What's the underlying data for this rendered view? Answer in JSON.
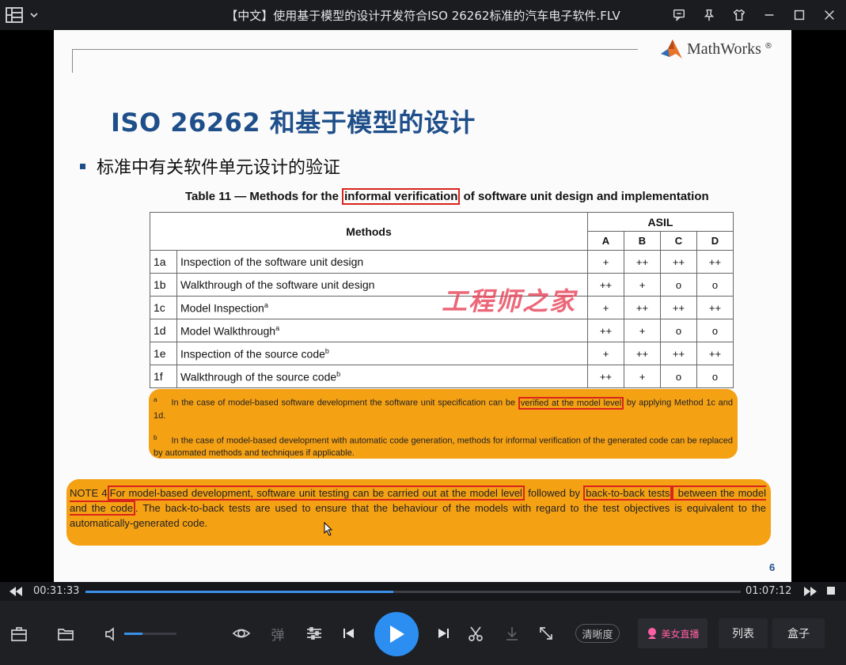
{
  "window": {
    "title": "【中文】使用基于模型的设计开发符合ISO 26262标准的汽车电子软件.FLV"
  },
  "slide": {
    "brand": "MathWorks",
    "brand_mark": "®",
    "title": "ISO 26262 和基于模型的设计",
    "bullet": "标准中有关软件单元设计的验证",
    "caption_pre": "Table 11 — Methods for the ",
    "caption_highlight": "informal verification",
    "caption_post": " of software unit design and implementation",
    "table": {
      "methods_header": "Methods",
      "asil_header": "ASIL",
      "levels": [
        "A",
        "B",
        "C",
        "D"
      ],
      "rows": [
        {
          "id": "1a",
          "name": "Inspection of the software unit design",
          "sup": "",
          "ratings": [
            "+",
            "++",
            "++",
            "++"
          ]
        },
        {
          "id": "1b",
          "name": "Walkthrough of the software unit design",
          "sup": "",
          "ratings": [
            "++",
            "+",
            "o",
            "o"
          ]
        },
        {
          "id": "1c",
          "name": "Model Inspection",
          "sup": "a",
          "ratings": [
            "+",
            "++",
            "++",
            "++"
          ]
        },
        {
          "id": "1d",
          "name": "Model Walkthrough",
          "sup": "a",
          "ratings": [
            "++",
            "+",
            "o",
            "o"
          ]
        },
        {
          "id": "1e",
          "name": "Inspection of the source code",
          "sup": "b",
          "ratings": [
            "+",
            "++",
            "++",
            "++"
          ]
        },
        {
          "id": "1f",
          "name": "Walkthrough of the source code",
          "sup": "b",
          "ratings": [
            "++",
            "+",
            "o",
            "o"
          ]
        }
      ]
    },
    "footnote_a": {
      "mark": "a",
      "pre": "In the case of model-based software development the software unit specification can be ",
      "highlight": "verified at the model level",
      "post": " by applying Method 1c and 1d."
    },
    "footnote_b": {
      "mark": "b",
      "text": "In the case of model-based development with automatic code generation, methods for informal verification of the generated code can be replaced by automated methods and techniques if applicable."
    },
    "note": {
      "label": "NOTE 4",
      "hl1": "For model-based development, software unit testing can be carried out at the model level",
      "t1": " followed by ",
      "hl2": "back-to-back tests",
      "hl3": " between the model and the code",
      "t2": ". The back-to-back tests are used to ensure that the behaviour of the models with regard to the test objectives is equivalent to the automatically-generated code."
    },
    "watermark": "工程师之家",
    "page_number": "6"
  },
  "player": {
    "current_time": "00:31:33",
    "total_time": "01:07:12",
    "progress": 0.47,
    "volume": 0.35,
    "danmaku_label": "弹",
    "quality_label": "清晰度",
    "live_label": "美女直播",
    "list_label": "列表",
    "box_label": "盒子"
  },
  "colors": {
    "accent": "#2b8ef0",
    "highlight_box": "#d9241c",
    "note_background": "#f5a114",
    "slide_title": "#1f4f8a",
    "watermark": "#e8465a"
  }
}
